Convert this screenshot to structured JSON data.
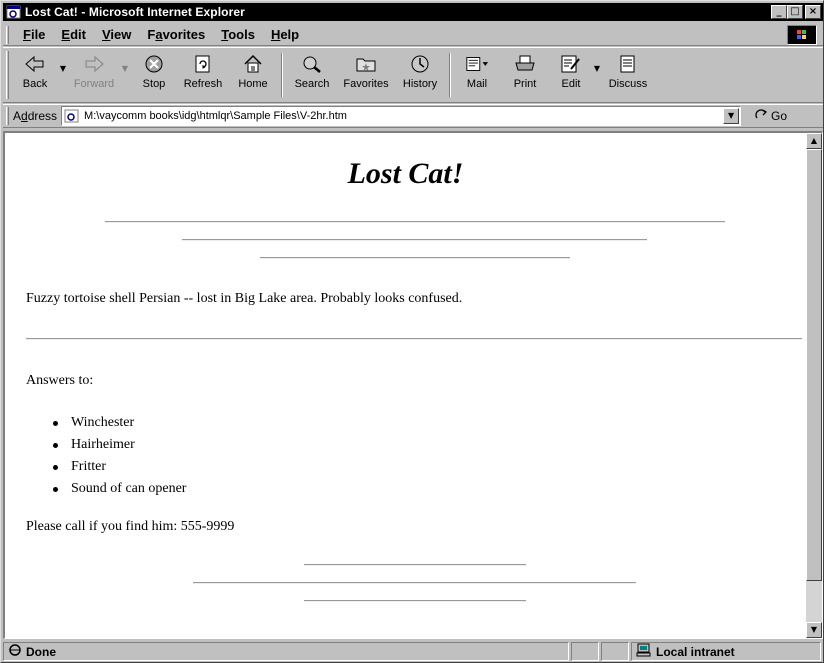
{
  "window": {
    "title": "Lost Cat! - Microsoft Internet Explorer",
    "controls": {
      "minimize": "_",
      "maximize": "□",
      "close": "×"
    }
  },
  "menu": [
    {
      "label": "File",
      "accel": "F",
      "rest": "ile"
    },
    {
      "label": "Edit",
      "accel": "E",
      "rest": "dit"
    },
    {
      "label": "View",
      "accel": "V",
      "rest": "iew"
    },
    {
      "label": "Favorites",
      "accel": "a",
      "pre": "F",
      "rest": "vorites"
    },
    {
      "label": "Tools",
      "accel": "T",
      "rest": "ools"
    },
    {
      "label": "Help",
      "accel": "H",
      "rest": "elp"
    }
  ],
  "toolbar": {
    "back": "Back",
    "forward": "Forward",
    "stop": "Stop",
    "refresh": "Refresh",
    "home": "Home",
    "search": "Search",
    "favorites": "Favorites",
    "history": "History",
    "mail": "Mail",
    "print": "Print",
    "edit": "Edit",
    "discuss": "Discuss"
  },
  "address": {
    "label": "Address",
    "accel": "d",
    "url": "M:\\vaycomm books\\idg\\htmlqr\\Sample Files\\V-2hr.htm",
    "go": "Go"
  },
  "page": {
    "heading": "Lost Cat!",
    "description": "Fuzzy tortoise shell Persian -- lost in Big Lake area. Probably looks confused.",
    "answers_label": "Answers to:",
    "names": [
      "Winchester",
      "Hairheimer",
      "Fritter",
      "Sound of can opener"
    ],
    "contact": "Please call if you find him: 555-9999"
  },
  "status": {
    "text": "Done",
    "zone": "Local intranet"
  },
  "colors": {
    "titlebar": "#000000",
    "chrome": "#c0c0c0",
    "content_bg": "#ffffff"
  }
}
